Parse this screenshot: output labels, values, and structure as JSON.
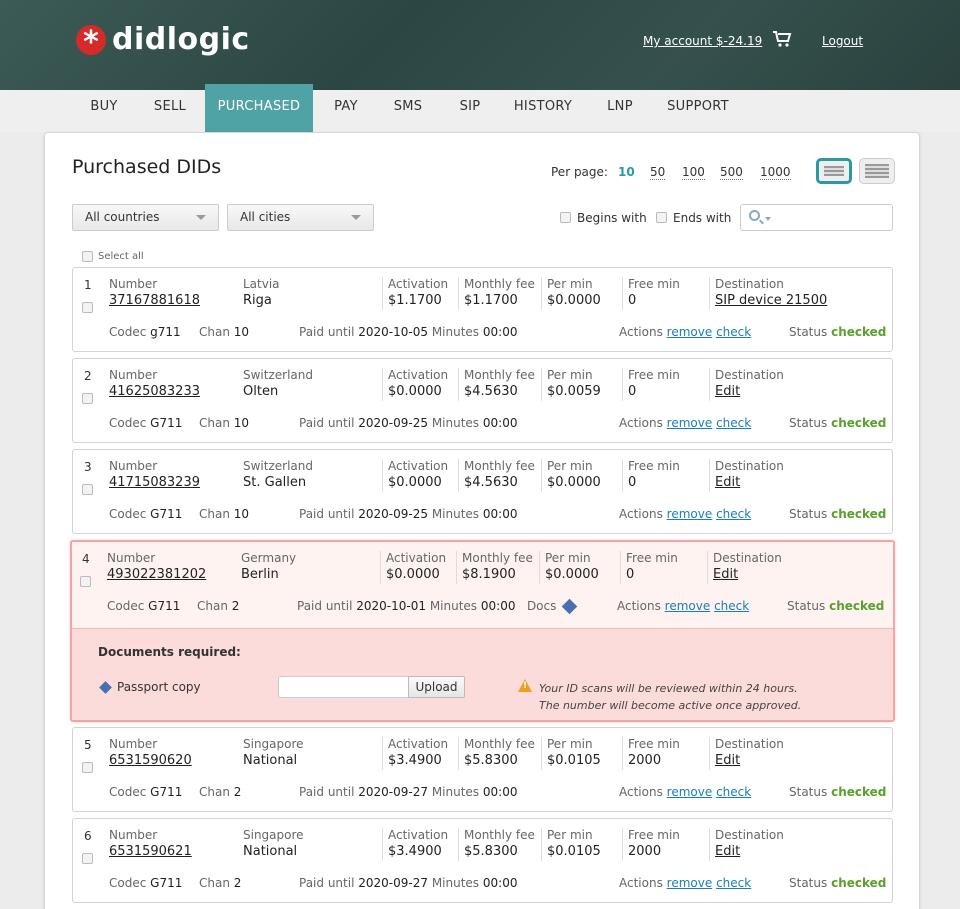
{
  "brand": {
    "name": "didlogic"
  },
  "header": {
    "account": "My account $-24.19",
    "logout": "Logout"
  },
  "nav": [
    "BUY",
    "SELL",
    "PURCHASED",
    "PAY",
    "SMS",
    "SIP",
    "HISTORY",
    "LNP",
    "SUPPORT"
  ],
  "nav_active": "PURCHASED",
  "page": {
    "title": "Purchased DIDs",
    "per_page_label": "Per page:",
    "per_page_options": [
      "10",
      "50",
      "100",
      "500",
      "1000"
    ],
    "per_page_selected": "10"
  },
  "filters": {
    "country": "All countries",
    "city": "All cities",
    "begins_with": "Begins with",
    "ends_with": "Ends with",
    "select_all": "Select all"
  },
  "labels": {
    "number": "Number",
    "activation": "Activation",
    "monthly_fee": "Monthly fee",
    "per_min": "Per min",
    "free_min": "Free min",
    "destination": "Destination",
    "codec": "Codec",
    "chan": "Chan",
    "paid_until": "Paid until",
    "minutes": "Minutes",
    "docs": "Docs",
    "actions": "Actions",
    "remove": "remove",
    "check": "check",
    "status": "Status"
  },
  "rows": [
    {
      "idx": "1",
      "number": "37167881618",
      "country": "Latvia",
      "city": "Riga",
      "activation": "$1.1700",
      "monthly_fee": "$1.1700",
      "per_min": "$0.0000",
      "free_min": "0",
      "destination": "SIP device 21500",
      "codec": "g711",
      "chan": "10",
      "paid_until": "2020-10-05",
      "minutes": "00:00",
      "status": "checked"
    },
    {
      "idx": "2",
      "number": "41625083233",
      "country": "Switzerland",
      "city": "Olten",
      "activation": "$0.0000",
      "monthly_fee": "$4.5630",
      "per_min": "$0.0059",
      "free_min": "0",
      "destination": "Edit",
      "codec": "G711",
      "chan": "10",
      "paid_until": "2020-09-25",
      "minutes": "00:00",
      "status": "checked"
    },
    {
      "idx": "3",
      "number": "41715083239",
      "country": "Switzerland",
      "city": "St. Gallen",
      "activation": "$0.0000",
      "monthly_fee": "$4.5630",
      "per_min": "$0.0000",
      "free_min": "0",
      "destination": "Edit",
      "codec": "G711",
      "chan": "10",
      "paid_until": "2020-09-25",
      "minutes": "00:00",
      "status": "checked"
    },
    {
      "idx": "4",
      "number": "493022381202",
      "country": "Germany",
      "city": "Berlin",
      "activation": "$0.0000",
      "monthly_fee": "$8.1900",
      "per_min": "$0.0000",
      "free_min": "0",
      "destination": "Edit",
      "codec": "G711",
      "chan": "2",
      "paid_until": "2020-10-01",
      "minutes": "00:00",
      "status": "checked"
    },
    {
      "idx": "5",
      "number": "6531590620",
      "country": "Singapore",
      "city": "National",
      "activation": "$3.4900",
      "monthly_fee": "$5.8300",
      "per_min": "$0.0105",
      "free_min": "2000",
      "destination": "Edit",
      "codec": "G711",
      "chan": "2",
      "paid_until": "2020-09-27",
      "minutes": "00:00",
      "status": "checked"
    },
    {
      "idx": "6",
      "number": "6531590621",
      "country": "Singapore",
      "city": "National",
      "activation": "$3.4900",
      "monthly_fee": "$5.8300",
      "per_min": "$0.0105",
      "free_min": "2000",
      "destination": "Edit",
      "codec": "G711",
      "chan": "2",
      "paid_until": "2020-09-27",
      "minutes": "00:00",
      "status": "checked"
    }
  ],
  "documents": {
    "title": "Documents required:",
    "item": "Passport copy",
    "upload": "Upload",
    "warning_line1": "Your ID scans will be reviewed within 24 hours.",
    "warning_line2": "The number will become active once approved."
  }
}
